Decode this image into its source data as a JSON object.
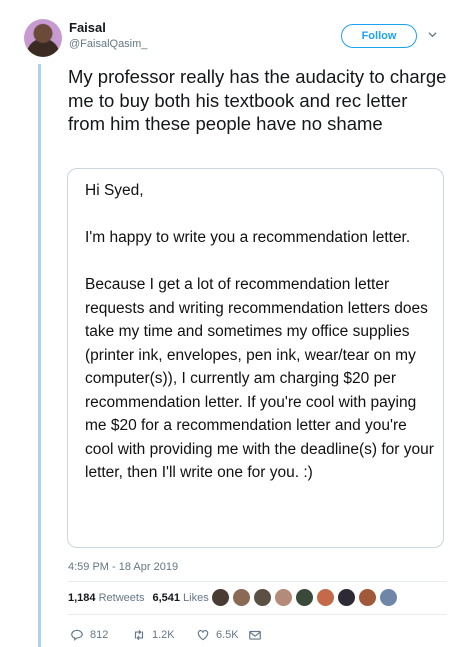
{
  "author": {
    "name": "Faisal",
    "handle": "@FaisalQasim_",
    "follow_label": "Follow"
  },
  "tweet": {
    "text": "My professor really has the audacity to charge me to buy both his textbook and rec letter from him these people have no shame",
    "image_letter": {
      "greeting": "Hi Syed,",
      "paragraph1": "I'm happy to write you a recommendation letter.",
      "paragraph2": "Because I get a lot of recommendation letter requests and writing recommendation letters does take my time and sometimes my office supplies (printer ink, envelopes, pen ink, wear/tear on my computer(s)), I currently am charging $20 per recommendation letter. If you're cool with paying me $20 for a recommendation letter and you're cool with providing me with the deadline(s) for your letter, then I'll write one for you. :)"
    },
    "timestamp": "4:59 PM - 18 Apr 2019"
  },
  "stats": {
    "retweets_count": "1,184",
    "retweets_label": "Retweets",
    "likes_count": "6,541",
    "likes_label": "Likes"
  },
  "likers": [
    {
      "color": "#4a3b34"
    },
    {
      "color": "#8a6a55"
    },
    {
      "color": "#5c4f44"
    },
    {
      "color": "#b48a78"
    },
    {
      "color": "#3a4a3a"
    },
    {
      "color": "#c46a4a"
    },
    {
      "color": "#2d2a35"
    },
    {
      "color": "#a05a3a"
    },
    {
      "color": "#6f86a8"
    }
  ],
  "actions": {
    "replies": "812",
    "retweets": "1.2K",
    "likes": "6.5K"
  },
  "colors": {
    "accent": "#1da1f2",
    "thread_line": "#a8d4ef",
    "muted": "#657786"
  }
}
